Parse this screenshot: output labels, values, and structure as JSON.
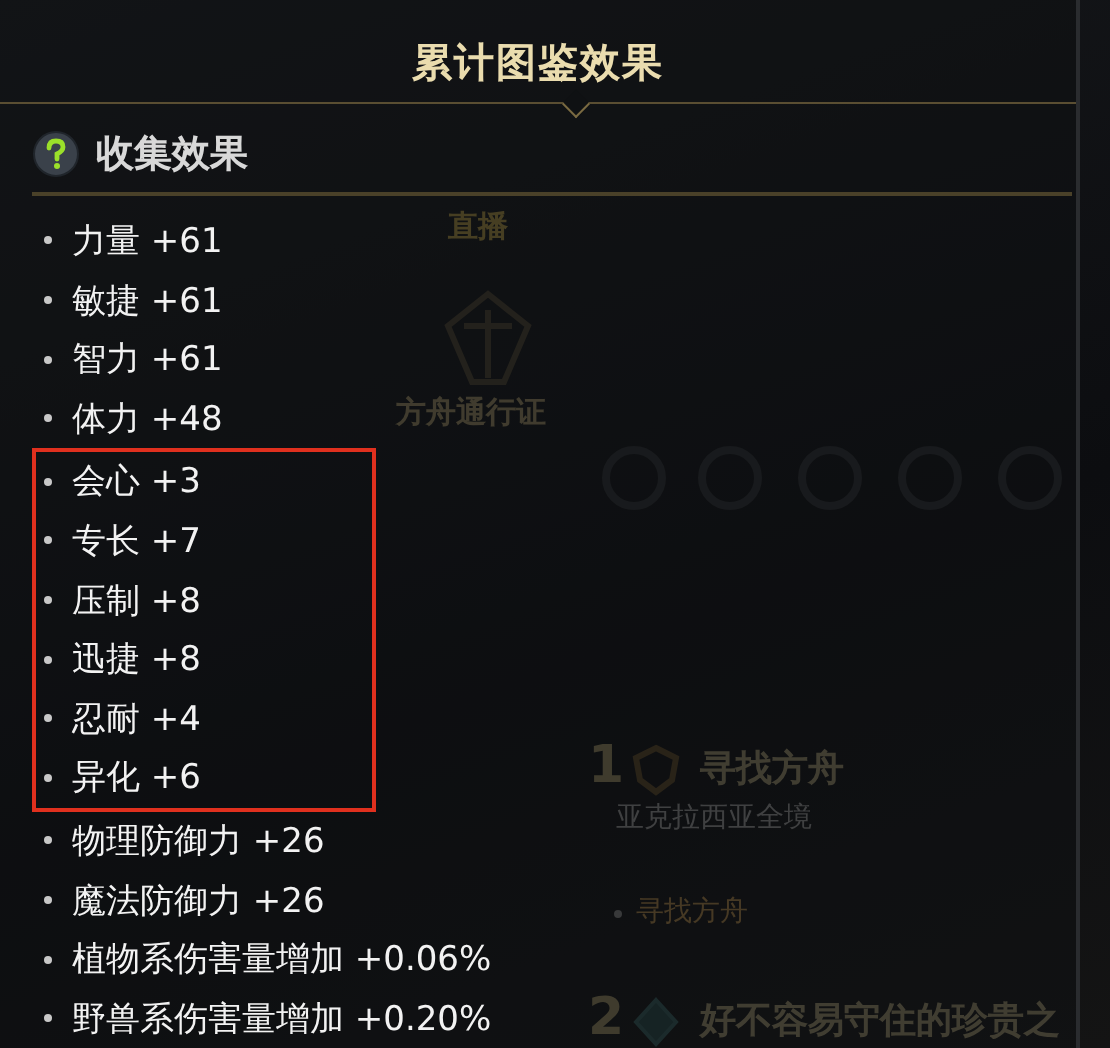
{
  "title": "累计图鉴效果",
  "section": {
    "title": "收集效果"
  },
  "effects": [
    {
      "text": "力量 +61",
      "highlighted": false
    },
    {
      "text": "敏捷 +61",
      "highlighted": false
    },
    {
      "text": "智力 +61",
      "highlighted": false
    },
    {
      "text": "体力 +48",
      "highlighted": false
    },
    {
      "text": "会心 +3",
      "highlighted": true
    },
    {
      "text": "专长 +7",
      "highlighted": true
    },
    {
      "text": "压制 +8",
      "highlighted": true
    },
    {
      "text": "迅捷 +8",
      "highlighted": true
    },
    {
      "text": "忍耐 +4",
      "highlighted": true
    },
    {
      "text": "异化 +6",
      "highlighted": true
    },
    {
      "text": "物理防御力 +26",
      "highlighted": false
    },
    {
      "text": "魔法防御力 +26",
      "highlighted": false
    },
    {
      "text": "植物系伤害量增加 +0.06%",
      "highlighted": false
    },
    {
      "text": "野兽系伤害量增加 +0.20%",
      "highlighted": false
    }
  ],
  "background": {
    "live_label": "直播",
    "pass_label": "方舟通行证",
    "quests": [
      {
        "kind": "shield",
        "number": "1",
        "title": "寻找方舟",
        "region": "亚克拉西亚全境",
        "objective": "寻找方舟"
      },
      {
        "kind": "diamond",
        "number": "2",
        "title": "好不容易守住的珍贵之"
      }
    ]
  }
}
